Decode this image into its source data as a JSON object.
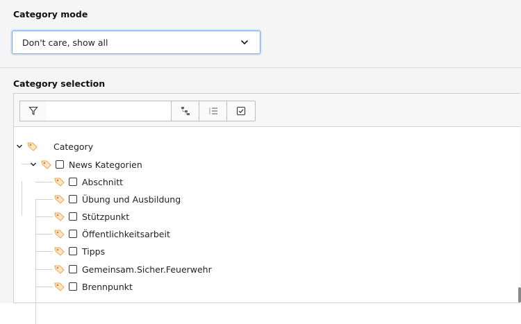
{
  "category_mode": {
    "title": "Category mode",
    "selected": "Don't care, show all"
  },
  "category_selection": {
    "title": "Category selection",
    "search": {
      "placeholder": "",
      "value": ""
    },
    "toolbar_icons": [
      "filter-icon",
      "collapse-tree-icon",
      "expand-list-icon",
      "check-all-icon"
    ],
    "tree": {
      "root": {
        "label": "Category",
        "expanded": true
      },
      "group": {
        "label": "News Kategorien",
        "expanded": true,
        "checked": false
      },
      "items": [
        {
          "label": "Abschnitt",
          "checked": false
        },
        {
          "label": "Übung und Ausbildung",
          "checked": false
        },
        {
          "label": "Stützpunkt",
          "checked": false
        },
        {
          "label": "Öffentlichkeitsarbeit",
          "checked": false
        },
        {
          "label": "Tipps",
          "checked": false
        },
        {
          "label": "Gemeinsam.Sicher.Feuerwehr",
          "checked": false
        },
        {
          "label": "Brennpunkt",
          "checked": false
        }
      ]
    }
  },
  "colors": {
    "tag_icon": "#f2a24a",
    "focus_border": "#7aa5d6",
    "panel_bg": "#f5f5f5"
  }
}
